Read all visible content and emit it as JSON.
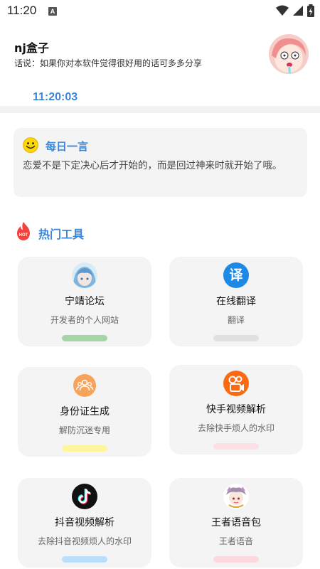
{
  "status_bar": {
    "time": "11:20",
    "notification_badge": "A"
  },
  "header": {
    "name": "nj盒子",
    "subtitle": "话说：如果你对本软件觉得很好用的话可多多分享",
    "clock": "11:20:03"
  },
  "quote": {
    "icon": "smiley-icon",
    "title": "每日一言",
    "text": "恋爱不是下定决心后才开始的，而是回过神来时就开始了哦。"
  },
  "section": {
    "icon": "hot-fire-icon",
    "title": "热门工具"
  },
  "tools": [
    {
      "name": "宁靖论坛",
      "desc": "开发者的个人网站",
      "bar_color": "#a5d6a7",
      "icon": "anime-avatar-icon"
    },
    {
      "name": "在线翻译",
      "desc": "翻译",
      "bar_color": "#e0e0e0",
      "icon": "translate-icon",
      "glyph": "译"
    },
    {
      "name": "身份证生成",
      "desc": "解防沉迷专用",
      "bar_color": "#fff59d",
      "icon": "people-icon"
    },
    {
      "name": "快手视频解析",
      "desc": "去除快手烦人的水印",
      "bar_color": "#fde0e6",
      "icon": "kuaishou-icon"
    },
    {
      "name": "抖音视频解析",
      "desc": "去除抖音视频烦人的水印",
      "bar_color": "#bbdefb",
      "icon": "tiktok-icon"
    },
    {
      "name": "王者语音包",
      "desc": "王者语音",
      "bar_color": "#fdd9df",
      "icon": "game-character-icon"
    }
  ]
}
